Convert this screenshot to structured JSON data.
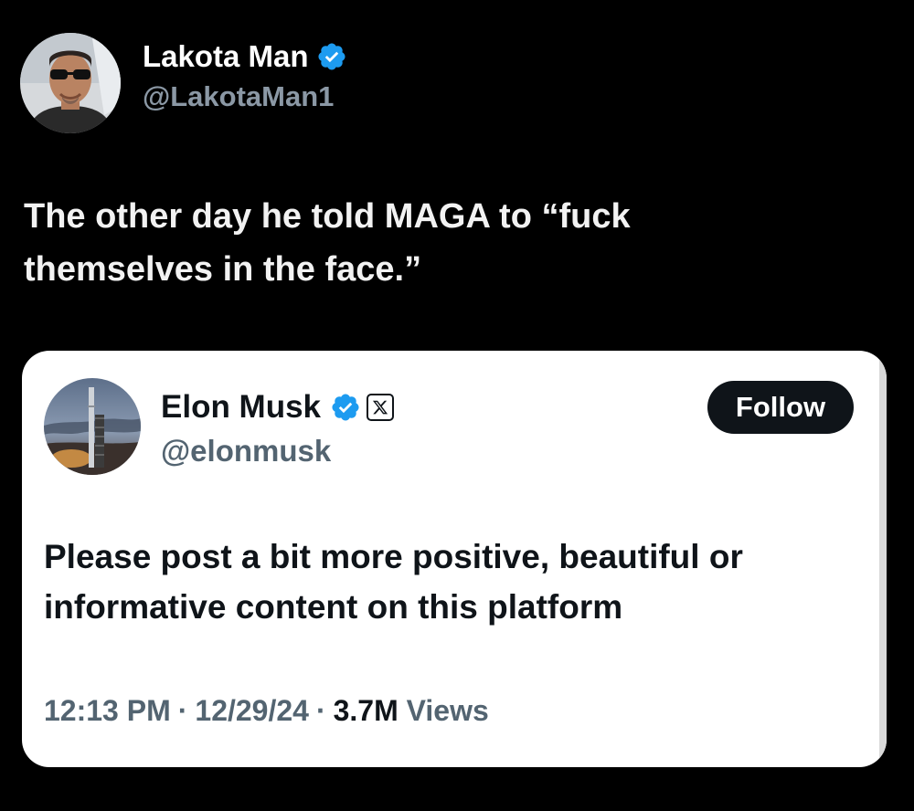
{
  "outer_post": {
    "author": {
      "name": "Lakota Man",
      "handle": "@LakotaMan1",
      "verified": true
    },
    "text": "The other day he told MAGA to “fuck themselves in the face.”"
  },
  "quoted_post": {
    "author": {
      "name": "Elon Musk",
      "handle": "@elonmusk",
      "verified": true,
      "affiliate_badge": "X"
    },
    "follow_label": "Follow",
    "text": "Please post a bit more positive, beautiful or informative content on this platform",
    "time": "12:13 PM",
    "date": "12/29/24",
    "views_count": "3.7M",
    "views_label": "Views",
    "separator": "·"
  },
  "colors": {
    "background": "#000000",
    "card": "#ffffff",
    "verified_blue": "#1d9bf0",
    "handle_dark_theme": "#8b98a5",
    "handle_light_theme": "#536471",
    "text_dark": "#0f1419"
  },
  "icons": {
    "verified": "verified-badge-icon",
    "affiliate": "x-logo-icon"
  }
}
